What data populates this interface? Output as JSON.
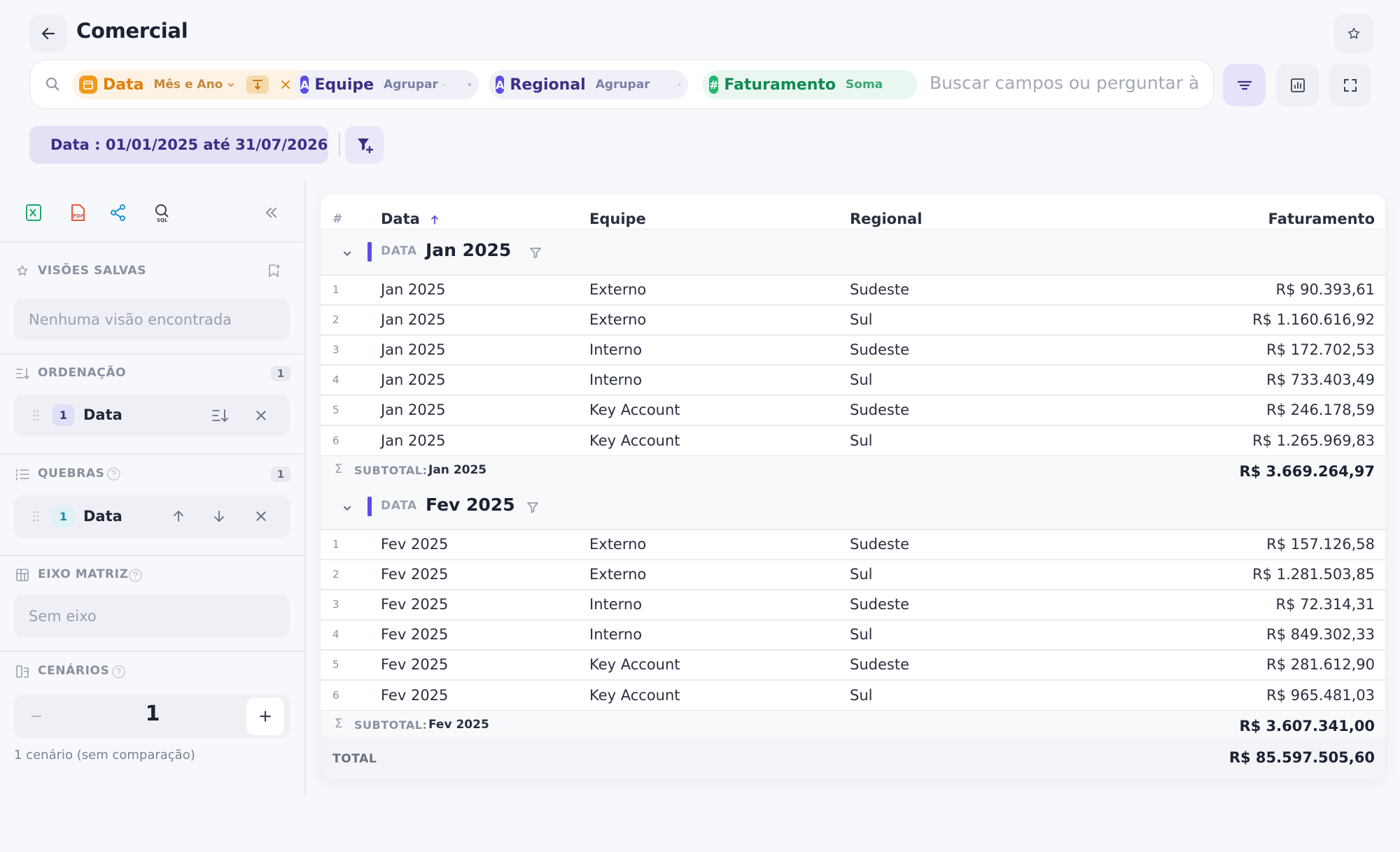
{
  "header": {
    "title": "Comercial"
  },
  "search": {
    "chips": [
      {
        "name": "Data",
        "agg": "Mês e Ano",
        "type": "date",
        "color": "#f29a1f"
      },
      {
        "name": "Equipe",
        "agg": "Agrupar",
        "type": "text",
        "badge": "A",
        "color": "#5b4ee6"
      },
      {
        "name": "Regional",
        "agg": "Agrupar",
        "type": "text",
        "badge": "A",
        "color": "#5b4ee6"
      },
      {
        "name": "Faturamento",
        "agg": "Soma",
        "type": "number",
        "badge": "#",
        "color": "#1eb871"
      }
    ],
    "placeholder": "Buscar campos ou perguntar à I"
  },
  "filters": {
    "date_label": "Data : 01/01/2025 até 31/07/2026"
  },
  "sidebar": {
    "saved_views": {
      "title": "VISÕES SALVAS",
      "empty": "Nenhuma visão encontrada"
    },
    "ordering": {
      "title": "ORDENAÇÃO",
      "count": "1",
      "item_num": "1",
      "item_label": "Data"
    },
    "breaks": {
      "title": "QUEBRAS",
      "count": "1",
      "item_num": "1",
      "item_label": "Data"
    },
    "matrix_axis": {
      "title": "EIXO MATRIZ",
      "empty": "Sem eixo"
    },
    "scenarios": {
      "title": "CENÁRIOS",
      "value": "1",
      "note": "1 cenário (sem comparação)"
    }
  },
  "table": {
    "headers": {
      "index": "#",
      "data": "Data",
      "equipe": "Equipe",
      "regional": "Regional",
      "faturamento": "Faturamento"
    },
    "group_key": "DATA",
    "subtotal_label": "SUBTOTAL:",
    "groups": [
      {
        "label": "Jan 2025",
        "subtotal": "R$ 3.669.264,97",
        "rows": [
          {
            "i": "1",
            "data": "Jan 2025",
            "equipe": "Externo",
            "regional": "Sudeste",
            "fat": "R$ 90.393,61"
          },
          {
            "i": "2",
            "data": "Jan 2025",
            "equipe": "Externo",
            "regional": "Sul",
            "fat": "R$ 1.160.616,92"
          },
          {
            "i": "3",
            "data": "Jan 2025",
            "equipe": "Interno",
            "regional": "Sudeste",
            "fat": "R$ 172.702,53"
          },
          {
            "i": "4",
            "data": "Jan 2025",
            "equipe": "Interno",
            "regional": "Sul",
            "fat": "R$ 733.403,49"
          },
          {
            "i": "5",
            "data": "Jan 2025",
            "equipe": "Key Account",
            "regional": "Sudeste",
            "fat": "R$ 246.178,59"
          },
          {
            "i": "6",
            "data": "Jan 2025",
            "equipe": "Key Account",
            "regional": "Sul",
            "fat": "R$ 1.265.969,83"
          }
        ]
      },
      {
        "label": "Fev 2025",
        "subtotal": "R$ 3.607.341,00",
        "rows": [
          {
            "i": "1",
            "data": "Fev 2025",
            "equipe": "Externo",
            "regional": "Sudeste",
            "fat": "R$ 157.126,58"
          },
          {
            "i": "2",
            "data": "Fev 2025",
            "equipe": "Externo",
            "regional": "Sul",
            "fat": "R$ 1.281.503,85"
          },
          {
            "i": "3",
            "data": "Fev 2025",
            "equipe": "Interno",
            "regional": "Sudeste",
            "fat": "R$ 72.314,31"
          },
          {
            "i": "4",
            "data": "Fev 2025",
            "equipe": "Interno",
            "regional": "Sul",
            "fat": "R$ 849.302,33"
          },
          {
            "i": "5",
            "data": "Fev 2025",
            "equipe": "Key Account",
            "regional": "Sudeste",
            "fat": "R$ 281.612,90"
          },
          {
            "i": "6",
            "data": "Fev 2025",
            "equipe": "Key Account",
            "regional": "Sul",
            "fat": "R$ 965.481,03"
          }
        ]
      }
    ],
    "total_label": "TOTAL",
    "total_value": "R$ 85.597.505,60"
  },
  "colors": {
    "accent": "#5b4ee6",
    "date_chip": "#f29a1f",
    "number_chip": "#1eb871"
  }
}
